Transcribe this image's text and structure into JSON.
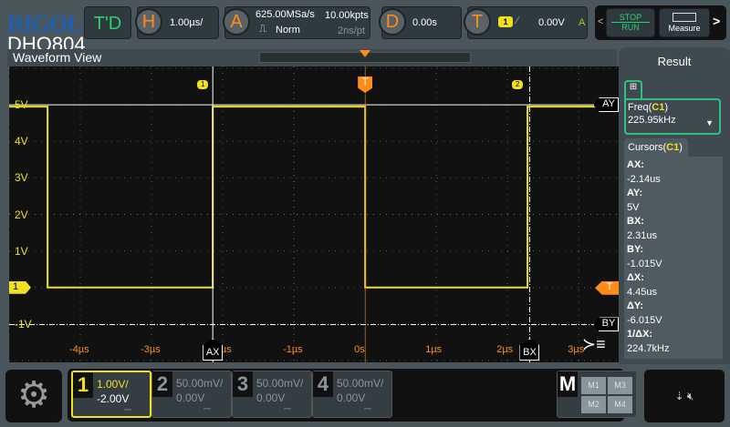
{
  "brand": {
    "logo": "RIGOL",
    "model": "DHO804"
  },
  "topbar": {
    "td": "T'D",
    "horizontal": {
      "icon": "H",
      "scale": "1.00µs/"
    },
    "acquire": {
      "icon": "A",
      "sample_rate": "625.00MSa/s",
      "mode": "Norm",
      "memory": "10.00kpts",
      "resolution": "2ns/pt"
    },
    "delay": {
      "icon": "D",
      "value": "0.00s"
    },
    "trigger": {
      "icon": "T",
      "source": "1",
      "level": "0.00V",
      "status": "A"
    },
    "stop_label": "STOP",
    "run_label": "RUN",
    "measure_label": "Measure"
  },
  "waveform_view": {
    "title": "Waveform View",
    "y_labels": [
      "5V",
      "4V",
      "3V",
      "2V",
      "1V",
      "-1V"
    ],
    "x_labels": [
      "-4µs",
      "-3µs",
      "-2µs",
      "-1µs",
      "0s",
      "1µs",
      "2µs",
      "3µs"
    ],
    "channel_marker": "1",
    "trigger_marker": "T",
    "trigger_level_marker": "T",
    "edge_markers": [
      "1",
      "2"
    ],
    "cursors": {
      "ax": "AX",
      "bx": "BX",
      "ay": "AY",
      "by": "BY"
    },
    "trace_color": "#f0e020"
  },
  "waveform": {
    "x_range_us": [
      -5,
      3.56
    ],
    "y_range_v": [
      -2.05,
      6.05
    ],
    "edges_us": [
      -4.46,
      -2.14,
      0,
      2.28
    ],
    "high_v": 4.95,
    "low_v": 0,
    "cursor_ax_us": -2.14,
    "cursor_bx_us": 2.31,
    "cursor_ay_v": 5,
    "cursor_by_v": -1.015
  },
  "result": {
    "title": "Result",
    "freq_label": "Freq(",
    "freq_ch": "C1",
    "freq_close": ")",
    "freq_value": "225.95kHz",
    "cursors_label": "Cursors(",
    "cursors_ch": "C1",
    "cursors_close": ")",
    "items": [
      {
        "k": "AX:",
        "v": "-2.14us"
      },
      {
        "k": "AY:",
        "v": "5V"
      },
      {
        "k": "BX:",
        "v": "2.31us"
      },
      {
        "k": "BY:",
        "v": "-1.015V"
      },
      {
        "k": "ΔX:",
        "v": "4.45us"
      },
      {
        "k": "ΔY:",
        "v": "-6.015V"
      },
      {
        "k": "1/ΔX:",
        "v": "224.7kHz"
      }
    ]
  },
  "channels": [
    {
      "n": "1",
      "scale": "1.00V/",
      "offset": "-2.00V",
      "coupling": "⎓"
    },
    {
      "n": "2",
      "scale": "50.00mV/",
      "offset": "0.00V",
      "coupling": "⎓"
    },
    {
      "n": "3",
      "scale": "50.00mV/",
      "offset": "0.00V",
      "coupling": "⎓"
    },
    {
      "n": "4",
      "scale": "50.00mV/",
      "offset": "0.00V",
      "coupling": "⎓"
    }
  ],
  "math": {
    "label": "M",
    "items": [
      "M1",
      "M3",
      "M2",
      "M4"
    ]
  }
}
